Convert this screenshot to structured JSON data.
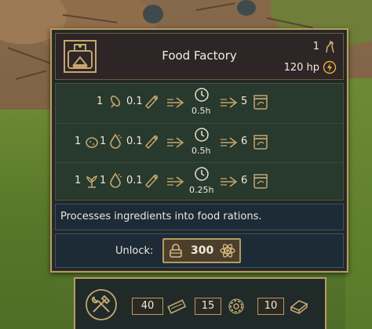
{
  "building": {
    "title": "Food Factory",
    "count": "1",
    "hp": "120 hp",
    "icon": "factory-building-icon"
  },
  "recipes": [
    {
      "inputs": [
        {
          "qty": "1",
          "icon": "grain-icon"
        }
      ],
      "fuel": {
        "qty": "0.1",
        "icon": "wood-log-icon"
      },
      "time": "0.5h",
      "output": {
        "qty": "5",
        "icon": "food-ration-jar-icon"
      }
    },
    {
      "inputs": [
        {
          "qty": "1",
          "icon": "potato-icon"
        },
        {
          "qty": "1",
          "icon": "water-drop-icon"
        }
      ],
      "fuel": {
        "qty": "0.1",
        "icon": "wood-log-icon"
      },
      "time": "0.5h",
      "output": {
        "qty": "6",
        "icon": "food-ration-jar-icon"
      }
    },
    {
      "inputs": [
        {
          "qty": "1",
          "icon": "herb-icon"
        },
        {
          "qty": "1",
          "icon": "water-drop-icon"
        }
      ],
      "fuel": {
        "qty": "0.1",
        "icon": "wood-log-icon"
      },
      "time": "0.25h",
      "output": {
        "qty": "6",
        "icon": "food-ration-jar-icon"
      }
    }
  ],
  "description": "Processes ingredients into food rations.",
  "unlock": {
    "label": "Unlock:",
    "cost": "300",
    "icon": "research-atom-icon"
  },
  "build_cost": [
    {
      "qty": "40",
      "icon": "wood-plank-icon"
    },
    {
      "qty": "15",
      "icon": "gear-icon"
    },
    {
      "qty": "10",
      "icon": "metal-plate-icon"
    }
  ],
  "colors": {
    "accent": "#b89a64",
    "panel": "#1f2a29",
    "header": "#2e2527",
    "recipes": "#28392d",
    "info": "#1c2b35"
  }
}
